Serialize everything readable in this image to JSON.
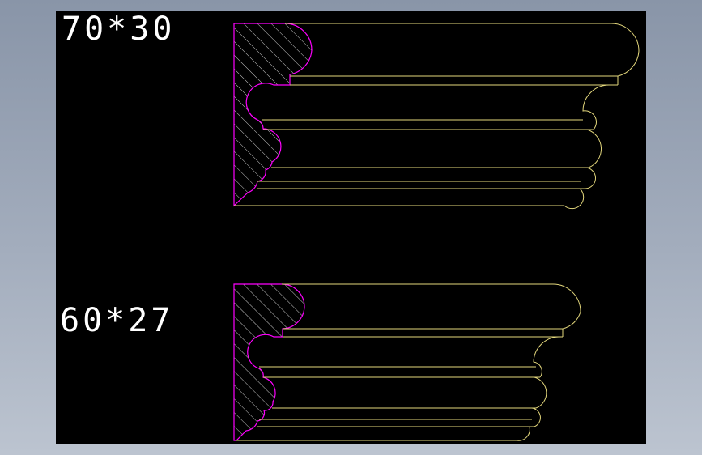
{
  "profiles": [
    {
      "label": "70*30"
    },
    {
      "label": "60*27"
    }
  ],
  "colors": {
    "background": "#000000",
    "profile_outline": "#e3d77c",
    "section_outline": "#ff00ff",
    "hatch": "#c8c8c8",
    "text": "#ffffff"
  }
}
